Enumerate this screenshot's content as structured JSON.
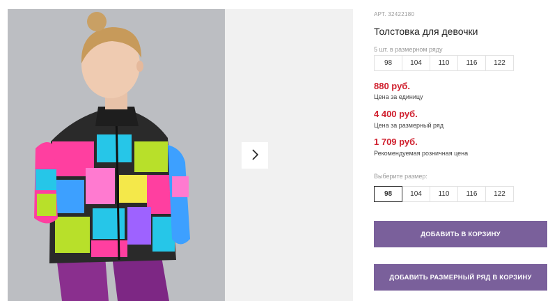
{
  "product": {
    "article_label": "АРТ.",
    "article_number": "32422180",
    "title": "Толстовка для девочки"
  },
  "size_series": {
    "label": "5 шт. в размерном ряду",
    "sizes": [
      "98",
      "104",
      "110",
      "116",
      "122"
    ]
  },
  "prices": [
    {
      "value": "880 руб.",
      "note": "Цена за единицу"
    },
    {
      "value": "4 400 руб.",
      "note": "Цена за размерный ряд"
    },
    {
      "value": "1 709 руб.",
      "note": "Рекомендуемая розничная цена"
    }
  ],
  "size_picker": {
    "label": "Выберите размер:",
    "sizes": [
      "98",
      "104",
      "110",
      "116",
      "122"
    ],
    "selected": "98"
  },
  "actions": {
    "add_to_cart": "ДОБАВИТЬ В КОРЗИНУ",
    "add_series_to_cart": "ДОБАВИТЬ РАЗМЕРНЫЙ РЯД В КОРЗИНУ"
  },
  "gallery": {
    "next_icon": "chevron-right-icon"
  },
  "colors": {
    "accent": "#7a609b",
    "price": "#d0202e"
  }
}
